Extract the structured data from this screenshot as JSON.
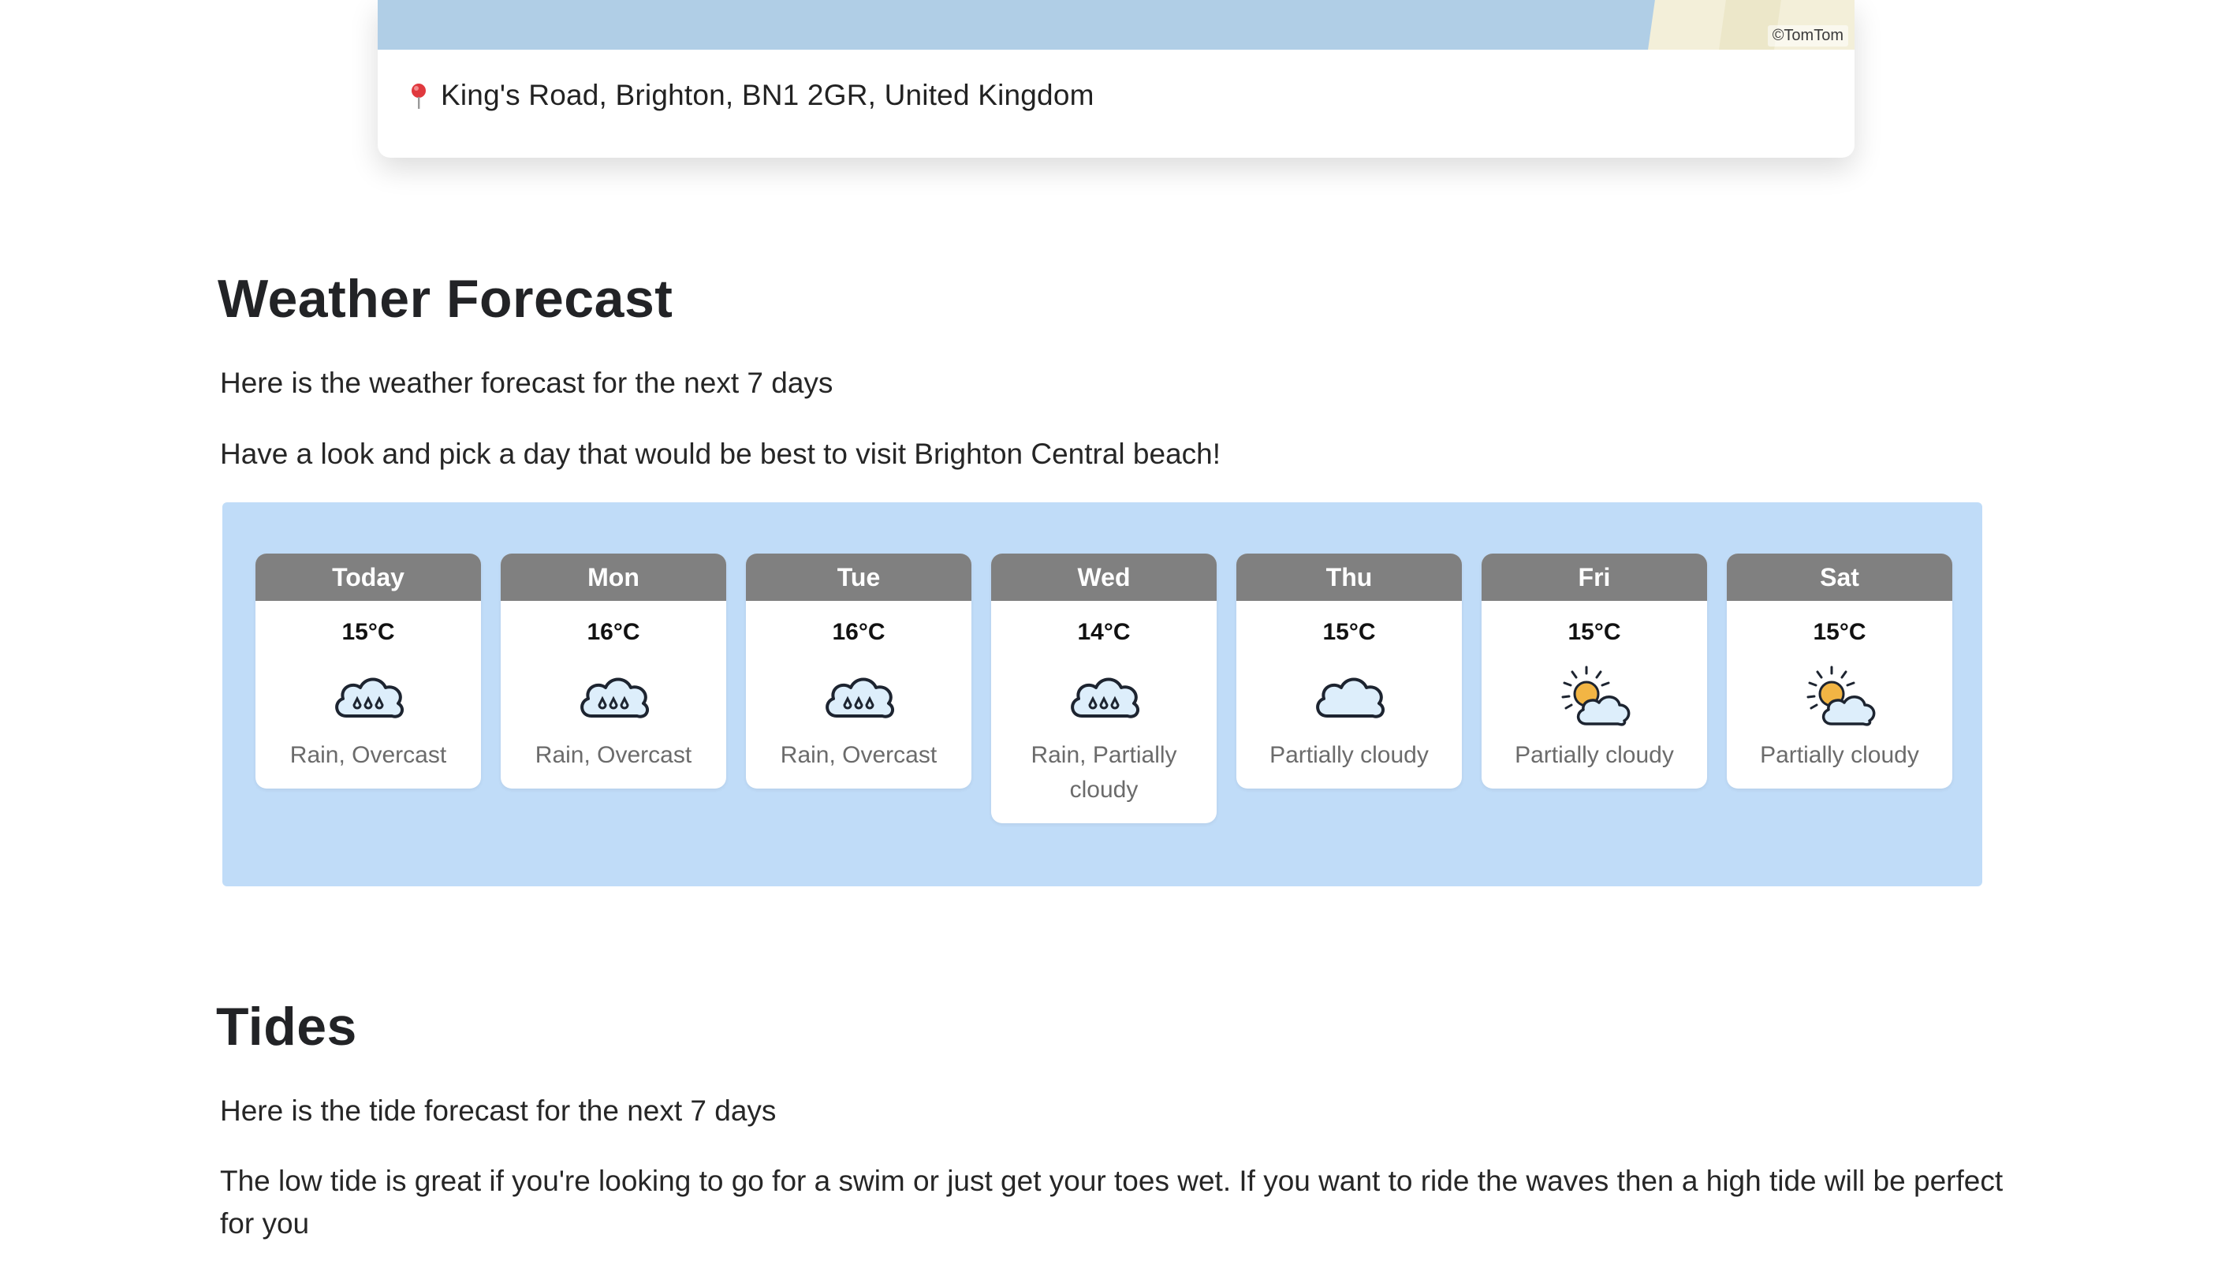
{
  "map": {
    "attribution": "©TomTom",
    "address": "King's Road, Brighton, BN1 2GR, United Kingdom",
    "pin_icon": "map-pin-icon"
  },
  "weather": {
    "heading": "Weather Forecast",
    "intro": "Here is the weather forecast for the next 7 days",
    "prompt": "Have a look and pick a day that would be best to visit Brighton Central beach!",
    "days": [
      {
        "day": "Today",
        "temp": "15°C",
        "icon": "rain-cloud-icon",
        "desc": "Rain, Overcast"
      },
      {
        "day": "Mon",
        "temp": "16°C",
        "icon": "rain-cloud-icon",
        "desc": "Rain, Overcast"
      },
      {
        "day": "Tue",
        "temp": "16°C",
        "icon": "rain-cloud-icon",
        "desc": "Rain, Overcast"
      },
      {
        "day": "Wed",
        "temp": "14°C",
        "icon": "rain-cloud-icon",
        "desc": "Rain, Partially cloudy"
      },
      {
        "day": "Thu",
        "temp": "15°C",
        "icon": "cloud-icon",
        "desc": "Partially cloudy"
      },
      {
        "day": "Fri",
        "temp": "15°C",
        "icon": "sun-cloud-icon",
        "desc": "Partially cloudy"
      },
      {
        "day": "Sat",
        "temp": "15°C",
        "icon": "sun-cloud-icon",
        "desc": "Partially cloudy"
      }
    ]
  },
  "tides": {
    "heading": "Tides",
    "intro": "Here is the tide forecast for the next 7 days",
    "body": "The low tide is great if you're looking to go for a swim or just get your toes wet. If you want to ride the waves then a high tide will be perfect for you"
  },
  "colors": {
    "panel_bg": "#c0dcf8",
    "card_header": "#808080",
    "map_water": "#b0cee6",
    "pin": "#e0393e",
    "sun": "#f2b544"
  }
}
